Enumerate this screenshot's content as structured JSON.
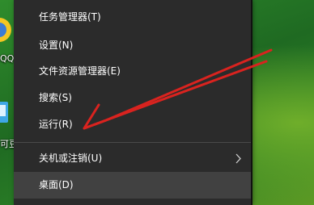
{
  "desktop": {
    "icon_labels": [
      "QQ",
      "可豆"
    ]
  },
  "context_menu": {
    "items": [
      {
        "label": "任务管理器(T)"
      },
      {
        "label": "设置(N)"
      },
      {
        "label": "文件资源管理器(E)"
      },
      {
        "label": "搜索(S)"
      },
      {
        "label": "运行(R)"
      },
      {
        "label": "关机或注销(U)"
      },
      {
        "label": "桌面(D)"
      }
    ],
    "submenu_indicator": "chevron-right-icon",
    "highlighted_item": "桌面(D)"
  },
  "annotation": {
    "color": "#d9231f",
    "icon": "red-arrow-pointer"
  }
}
